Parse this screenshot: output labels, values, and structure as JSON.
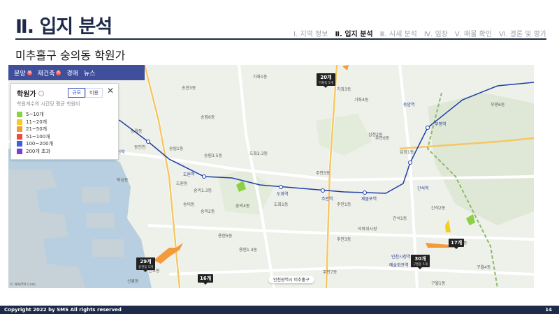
{
  "header": {
    "title": "Ⅱ. 입지 분석",
    "subtitle": "미추홀구 숭의동 학원가",
    "nav": [
      "Ⅰ. 지역 정보",
      "Ⅱ. 입지 분석",
      "Ⅲ. 시세 분석",
      "Ⅳ. 임장",
      "Ⅴ. 매물 확인",
      "Ⅵ. 결론 및 평가"
    ],
    "active_nav_index": 1
  },
  "map": {
    "tabs": [
      {
        "label": "분양",
        "badge": "N"
      },
      {
        "label": "재건축",
        "badge": "N"
      },
      {
        "label": "경매",
        "badge": ""
      },
      {
        "label": "뉴스",
        "badge": ""
      }
    ],
    "panel": {
      "title": "학원가",
      "desc": "학원개수의 시간당 평균 학원비",
      "toggle": [
        "규모",
        "비용"
      ],
      "selected_toggle": "규모",
      "legend": [
        {
          "label": "5~10개",
          "color": "#8bd143"
        },
        {
          "label": "11~20개",
          "color": "#f5cd1f"
        },
        {
          "label": "21~50개",
          "color": "#f39a3a"
        },
        {
          "label": "51~100개",
          "color": "#ef4b3d"
        },
        {
          "label": "100~200개",
          "color": "#3d5fe0"
        },
        {
          "label": "200개 초과",
          "color": "#7a3fd1"
        }
      ]
    },
    "markers": [
      {
        "count": "20개",
        "location": "가좌동 5개"
      },
      {
        "count": "29개",
        "location": "용현동 5개"
      },
      {
        "count": "16개",
        "location": ""
      },
      {
        "count": "17개",
        "location": ""
      },
      {
        "count": "30개",
        "location": "구월동 5개"
      }
    ],
    "places": {
      "p1": "가좌1동",
      "p2": "가좌3동",
      "p3": "가좌4동",
      "p4": "송현3동",
      "p5": "송림6동",
      "p6": "송림1동",
      "p7": "송림3.5동",
      "p8": "도화2.3동",
      "p9": "도화1동",
      "p10": "주안1동",
      "p11": "주안5동",
      "p12": "주안6동",
      "p13": "숭의1.3동",
      "p14": "숭의2동",
      "p15": "숭의4동",
      "p16": "용현5동",
      "p17": "용현1.4동",
      "p18": "신흥동",
      "p19": "주안3동",
      "p20": "주안7동",
      "p21": "십정1동",
      "p22": "십정2동",
      "p23": "간석2동",
      "p24": "간석1동",
      "p25": "구월1동",
      "p26": "구월4동",
      "p27": "부평6동",
      "p28": "북성동",
      "p29": "도원동",
      "p30": "신포동",
      "p31": "동인천",
      "p32": "송월동",
      "p33": "관교동",
      "p34": "숭의동",
      "p35": "석바위시장",
      "p36": "주안역",
      "p37": "도화역",
      "p38": "간석역",
      "p39": "부평역",
      "p40": "동암역",
      "p41": "인천역",
      "p42": "제물포역",
      "p43": "도원역",
      "p44": "인천시청역",
      "p45": "예술회관역"
    },
    "search_chip": "인천광역시 미추홀구",
    "copyright": "© NAVER Corp."
  },
  "footer": {
    "copyright": "Copyright 2022 by SMS  All rights reserved",
    "page": "14"
  },
  "colors": {
    "navy": "#1e2a4a",
    "tab_bar": "#3f4f9c",
    "subway_line": "#1f3ea8"
  }
}
